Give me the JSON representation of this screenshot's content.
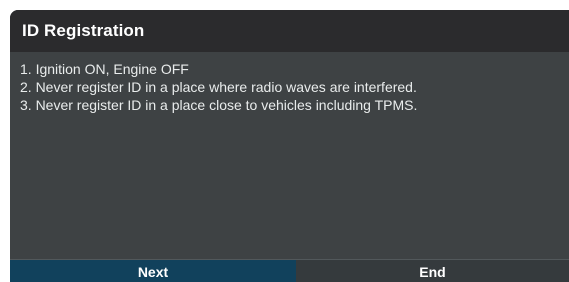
{
  "dialog": {
    "title": "ID Registration",
    "instructions": [
      "1. Ignition ON, Engine OFF",
      "2. Never register ID in a place where radio waves are interfered.",
      "3. Never register ID in a place close to vehicles including TPMS."
    ],
    "buttons": {
      "next_label": "Next",
      "end_label": "End"
    }
  },
  "colors": {
    "header_bg": "#2b2b2d",
    "body_bg": "#3e4244",
    "next_bg": "#11415c",
    "end_bg": "#353a3d"
  }
}
